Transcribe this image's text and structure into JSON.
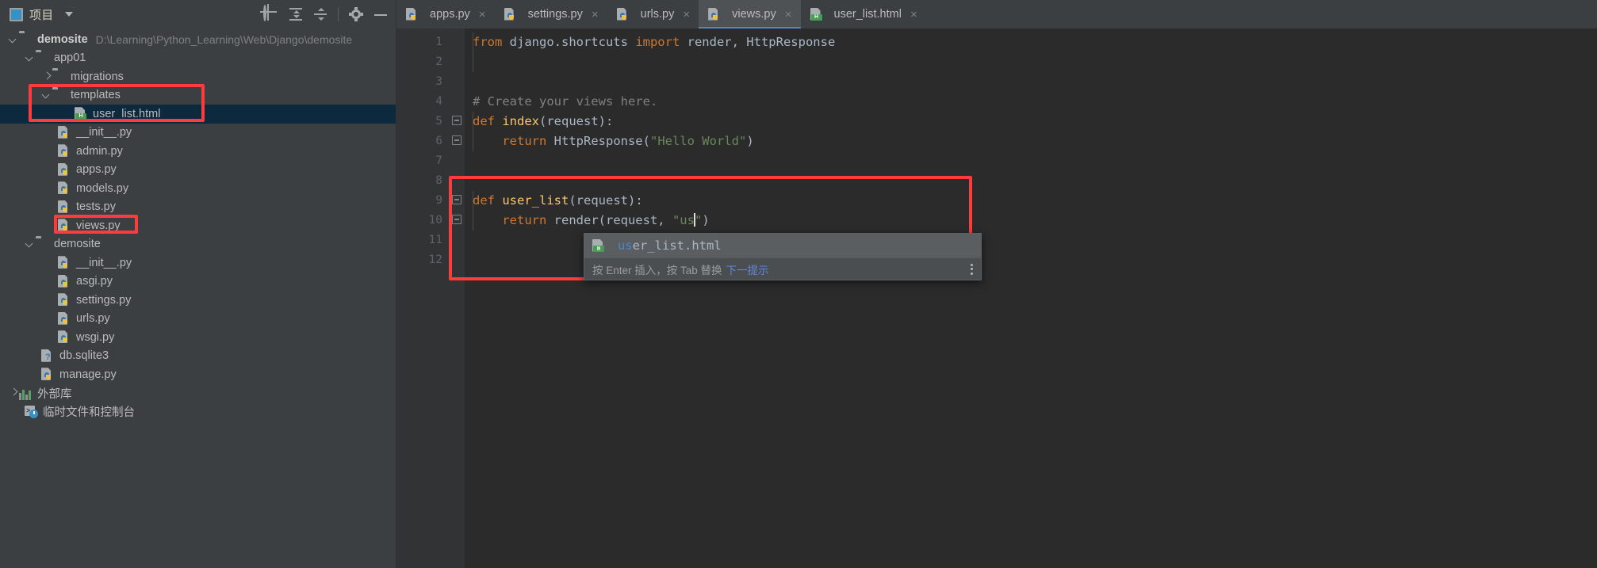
{
  "sidebar": {
    "header": {
      "title": "项目",
      "project_icon": "project-panel-icon",
      "dropdown_icon": "chevron-down-icon",
      "actions": [
        {
          "name": "locate-icon",
          "label": "选择打开文件"
        },
        {
          "name": "expand-all-icon",
          "label": "全部展开"
        },
        {
          "name": "collapse-all-icon",
          "label": "全部折叠"
        },
        {
          "name": "gear-icon",
          "label": "设置"
        },
        {
          "name": "minimize-icon",
          "label": "隐藏"
        }
      ]
    },
    "tree": [
      {
        "indent": 0,
        "arrow": "down",
        "icon": "folder",
        "label": "demosite",
        "bold": true,
        "path": "D:\\Learning\\Python_Learning\\Web\\Django\\demosite"
      },
      {
        "indent": 1,
        "arrow": "down",
        "icon": "folder-module",
        "label": "app01"
      },
      {
        "indent": 2,
        "arrow": "right",
        "icon": "folder-module",
        "label": "migrations"
      },
      {
        "indent": 2,
        "arrow": "down",
        "icon": "folder",
        "label": "templates"
      },
      {
        "indent": 3,
        "arrow": "none",
        "icon": "html-file",
        "label": "user_list.html",
        "selected": true
      },
      {
        "indent": 3,
        "arrow": "none",
        "icon": "py-file",
        "label": "__init__.py"
      },
      {
        "indent": 3,
        "arrow": "none",
        "icon": "py-file",
        "label": "admin.py"
      },
      {
        "indent": 3,
        "arrow": "none",
        "icon": "py-file",
        "label": "apps.py"
      },
      {
        "indent": 3,
        "arrow": "none",
        "icon": "py-file",
        "label": "models.py"
      },
      {
        "indent": 3,
        "arrow": "none",
        "icon": "py-file",
        "label": "tests.py"
      },
      {
        "indent": 3,
        "arrow": "none",
        "icon": "py-file",
        "label": "views.py"
      },
      {
        "indent": 1,
        "arrow": "down",
        "icon": "folder-module",
        "label": "demosite"
      },
      {
        "indent": 3,
        "arrow": "none",
        "icon": "py-file",
        "label": "__init__.py"
      },
      {
        "indent": 3,
        "arrow": "none",
        "icon": "py-file",
        "label": "asgi.py"
      },
      {
        "indent": 3,
        "arrow": "none",
        "icon": "py-file",
        "label": "settings.py"
      },
      {
        "indent": 3,
        "arrow": "none",
        "icon": "py-file",
        "label": "urls.py"
      },
      {
        "indent": 3,
        "arrow": "none",
        "icon": "py-file",
        "label": "wsgi.py"
      },
      {
        "indent": 2,
        "arrow": "none",
        "icon": "db-file",
        "label": "db.sqlite3"
      },
      {
        "indent": 2,
        "arrow": "none",
        "icon": "py-file",
        "label": "manage.py"
      },
      {
        "indent": 0,
        "arrow": "right",
        "icon": "library",
        "label": "外部库"
      },
      {
        "indent": 0,
        "arrow": "none",
        "icon": "console",
        "label": "临时文件和控制台"
      }
    ]
  },
  "tabs": [
    {
      "label": "apps.py",
      "icon": "py-file",
      "active": false,
      "close": "×"
    },
    {
      "label": "settings.py",
      "icon": "py-file",
      "active": false,
      "close": "×"
    },
    {
      "label": "urls.py",
      "icon": "py-file",
      "active": false,
      "close": "×"
    },
    {
      "label": "views.py",
      "icon": "py-file",
      "active": true,
      "close": "×"
    },
    {
      "label": "user_list.html",
      "icon": "html-file",
      "active": false,
      "close": "×"
    }
  ],
  "editor": {
    "line_numbers": [
      "1",
      "2",
      "3",
      "4",
      "5",
      "6",
      "7",
      "8",
      "9",
      "10",
      "11",
      "12"
    ],
    "lines": [
      {
        "n": 1,
        "text": "from django.shortcuts import render, HttpResponse"
      },
      {
        "n": 2,
        "text": ""
      },
      {
        "n": 3,
        "text": ""
      },
      {
        "n": 4,
        "text": "# Create your views here."
      },
      {
        "n": 5,
        "text": "def index(request):"
      },
      {
        "n": 6,
        "text": "    return HttpResponse(\"Hello World\")"
      },
      {
        "n": 7,
        "text": ""
      },
      {
        "n": 8,
        "text": ""
      },
      {
        "n": 9,
        "text": "def user_list(request):"
      },
      {
        "n": 10,
        "text": "    return render(request, \"us\")"
      },
      {
        "n": 11,
        "text": ""
      },
      {
        "n": 12,
        "text": ""
      }
    ],
    "tokens": {
      "l1_from": "from",
      "l1_mod": " django.shortcuts ",
      "l1_import": "import",
      "l1_rest": " render, HttpResponse",
      "l4_comment": "# Create your views here.",
      "l5_def": "def",
      "l5_name": " index",
      "l5_args": "(request):",
      "l6_return": "    return",
      "l6_call": " HttpResponse(",
      "l6_str": "\"Hello World\"",
      "l6_end": ")",
      "l9_def": "def",
      "l9_name": " user_list",
      "l9_args": "(request):",
      "l10_return": "    return",
      "l10_call": " render(request, ",
      "l10_str_open": "\"us",
      "l10_str_close": "\"",
      "l10_end": ")"
    }
  },
  "completion_popup": {
    "items": [
      {
        "icon": "html-file",
        "matched": "us",
        "rest": "er_list.html",
        "full_label": "user_list.html"
      }
    ],
    "footer": {
      "hint": "按 Enter 插入，按 Tab 替换",
      "link": "下一提示",
      "menu_icon": "kebab-menu-icon"
    }
  },
  "annotations": [
    {
      "name": "highlight-templates-folder"
    },
    {
      "name": "highlight-views-py"
    },
    {
      "name": "highlight-user-list-function"
    }
  ],
  "colors": {
    "keyword": "#cc7832",
    "function": "#ffc66d",
    "string": "#6a8759",
    "comment": "#808080",
    "identifier": "#a9b7c6",
    "accent": "#4a88c7",
    "annotation": "#ff3b3b",
    "editor_bg": "#2b2b2b",
    "panel_bg": "#3c3f41",
    "selection_bg": "#0d293e"
  }
}
